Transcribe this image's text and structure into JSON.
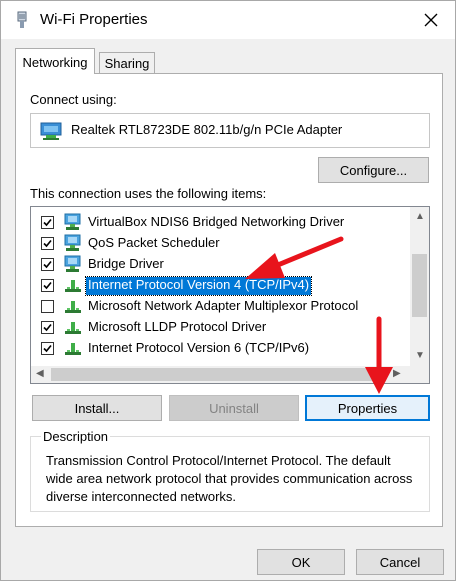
{
  "window": {
    "title": "Wi-Fi Properties",
    "close_glyph": "✕"
  },
  "tabs": [
    {
      "label": "Networking",
      "active": true
    },
    {
      "label": "Sharing",
      "active": false
    }
  ],
  "connect": {
    "label": "Connect using:",
    "adapter": "Realtek RTL8723DE 802.11b/g/n PCIe Adapter"
  },
  "configure_label": "Configure...",
  "items_label": "This connection uses the following items:",
  "items": [
    {
      "label": "VirtualBox NDIS6 Bridged Networking Driver",
      "checked": true,
      "icon": "network-service-icon"
    },
    {
      "label": "QoS Packet Scheduler",
      "checked": true,
      "icon": "network-service-icon"
    },
    {
      "label": "Bridge Driver",
      "checked": true,
      "icon": "network-service-icon"
    },
    {
      "label": "Internet Protocol Version 4 (TCP/IPv4)",
      "checked": true,
      "selected": true,
      "icon": "protocol-icon"
    },
    {
      "label": "Microsoft Network Adapter Multiplexor Protocol",
      "checked": false,
      "icon": "protocol-icon"
    },
    {
      "label": "Microsoft LLDP Protocol Driver",
      "checked": true,
      "icon": "protocol-icon"
    },
    {
      "label": "Internet Protocol Version 6 (TCP/IPv6)",
      "checked": true,
      "icon": "protocol-icon"
    }
  ],
  "buttons": {
    "install": "Install...",
    "uninstall": "Uninstall",
    "properties": "Properties"
  },
  "description": {
    "legend": "Description",
    "text": "Transmission Control Protocol/Internet Protocol. The default wide area network protocol that provides communication across diverse interconnected networks."
  },
  "footer": {
    "ok": "OK",
    "cancel": "Cancel"
  },
  "colors": {
    "selection": "#0078d7",
    "annotation_arrow": "#e8141c"
  }
}
